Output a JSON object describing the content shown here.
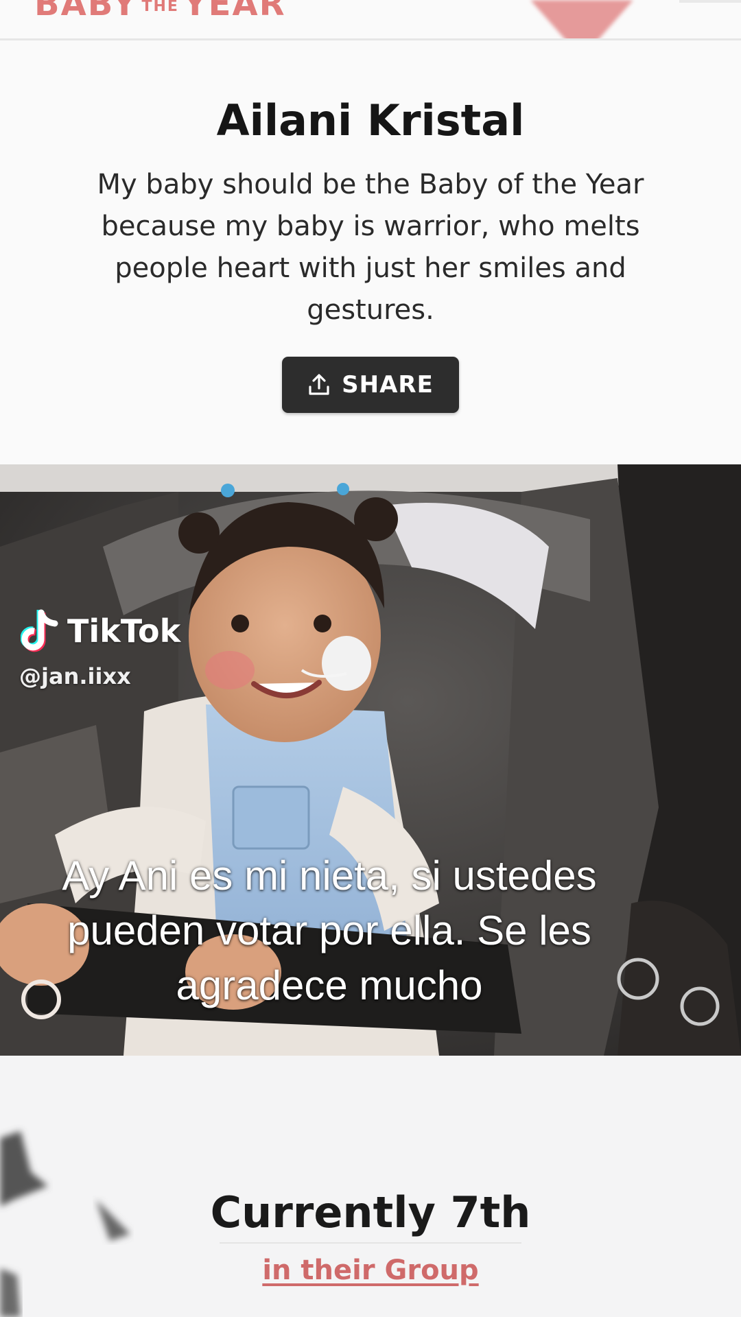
{
  "header": {
    "brand_left": "BABY",
    "brand_middle": "THE",
    "brand_right": "YEAR"
  },
  "profile": {
    "name": "Ailani Kristal",
    "description": "My baby should be the Baby of the Year because my baby is warrior, who melts people heart with just her smiles and gestures.",
    "share_label": "SHARE"
  },
  "video": {
    "platform": "TikTok",
    "handle": "@jan.iixx",
    "caption_lines": [
      "Ay Ani es mi nieta, si ustedes",
      "pueden votar por ella. Se les",
      "agradece mucho"
    ]
  },
  "ranking": {
    "title": "Currently 7th",
    "link": "in their Group"
  },
  "colors": {
    "brand": "#e07a78",
    "share_button": "#2d2d2d",
    "link": "#cf6a6a"
  },
  "icons": {
    "share": "share-upload-icon",
    "tiktok": "tiktok-note-icon",
    "heart": "heart-icon"
  }
}
